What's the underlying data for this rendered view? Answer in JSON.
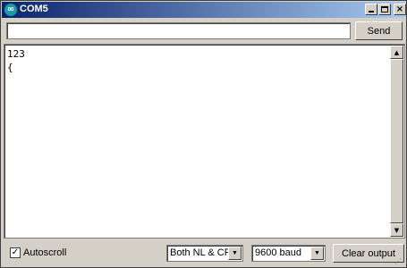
{
  "window": {
    "title": "COM5",
    "app_icon": "arduino-infinity-icon",
    "app_icon_glyph": "∞",
    "minimize_icon": "minimize-icon",
    "maximize_icon": "maximize-icon",
    "close_icon": "close-icon",
    "close_glyph": "×",
    "titlebar_gradient": [
      "#0a246a",
      "#a6caf0"
    ]
  },
  "input": {
    "value": "",
    "placeholder": ""
  },
  "send_button": {
    "label": "Send"
  },
  "output": {
    "lines": [
      "123",
      "{"
    ]
  },
  "scrollbar": {
    "up_glyph": "▲",
    "down_glyph": "▼"
  },
  "footer": {
    "autoscroll": {
      "label": "Autoscroll",
      "checked": true,
      "check_glyph": "✓"
    },
    "line_ending": {
      "selected": "Both NL & CR",
      "arrow_glyph": "▼"
    },
    "baud_rate": {
      "selected": "9600 baud",
      "arrow_glyph": "▼"
    },
    "clear_button": {
      "label": "Clear output"
    }
  }
}
